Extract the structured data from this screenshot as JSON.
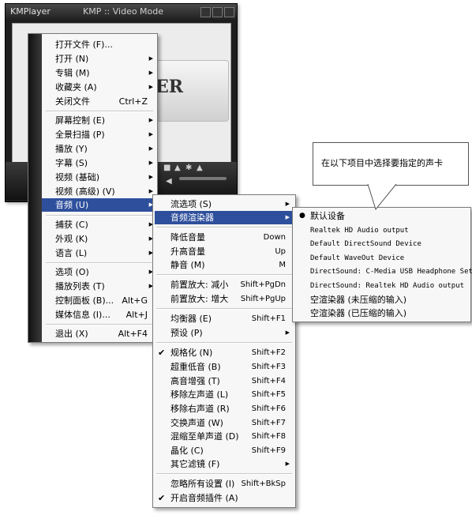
{
  "kmplayer": {
    "logo": "KMPlayer",
    "title": "KMP :: Video Mode",
    "logo_text": "ER"
  },
  "main_menu": {
    "items": [
      {
        "label": "打开文件 (F)...",
        "shortcut": "",
        "submenu": false
      },
      {
        "label": "打开 (N)",
        "shortcut": "",
        "submenu": true
      },
      {
        "label": "专辑 (M)",
        "shortcut": "",
        "submenu": true
      },
      {
        "label": "收藏夹 (A)",
        "shortcut": "",
        "submenu": true
      },
      {
        "label": "关闭文件",
        "shortcut": "Ctrl+Z",
        "submenu": false
      },
      {
        "label": "屏幕控制 (E)",
        "shortcut": "",
        "submenu": true
      },
      {
        "label": "全景扫描 (P)",
        "shortcut": "",
        "submenu": true
      },
      {
        "label": "播放 (Y)",
        "shortcut": "",
        "submenu": true
      },
      {
        "label": "字幕 (S)",
        "shortcut": "",
        "submenu": true
      },
      {
        "label": "视频 (基础)",
        "shortcut": "",
        "submenu": true
      },
      {
        "label": "视频 (高级) (V)",
        "shortcut": "",
        "submenu": true
      },
      {
        "label": "音频 (U)",
        "shortcut": "",
        "submenu": true
      },
      {
        "label": "捕获 (C)",
        "shortcut": "",
        "submenu": true
      },
      {
        "label": "外观 (K)",
        "shortcut": "",
        "submenu": true
      },
      {
        "label": "语言 (L)",
        "shortcut": "",
        "submenu": true
      },
      {
        "label": "选项 (O)",
        "shortcut": "",
        "submenu": true
      },
      {
        "label": "播放列表 (T)",
        "shortcut": "",
        "submenu": true
      },
      {
        "label": "控制面板 (B)...",
        "shortcut": "Alt+G",
        "submenu": false
      },
      {
        "label": "媒体信息 (I)...",
        "shortcut": "Alt+J",
        "submenu": false
      },
      {
        "label": "退出 (X)",
        "shortcut": "Alt+F4",
        "submenu": false
      }
    ]
  },
  "audio_menu": {
    "items": [
      {
        "label": "流选项 (S)",
        "shortcut": "",
        "submenu": true,
        "checked": false
      },
      {
        "label": "音频渲染器",
        "shortcut": "",
        "submenu": true,
        "checked": false
      },
      {
        "label": "降低音量",
        "shortcut": "Down",
        "submenu": false,
        "checked": false
      },
      {
        "label": "升高音量",
        "shortcut": "Up",
        "submenu": false,
        "checked": false
      },
      {
        "label": "静音 (M)",
        "shortcut": "M",
        "submenu": false,
        "checked": false
      },
      {
        "label": "前置放大: 减小",
        "shortcut": "Shift+PgDn",
        "submenu": false,
        "checked": false
      },
      {
        "label": "前置放大: 增大",
        "shortcut": "Shift+PgUp",
        "submenu": false,
        "checked": false
      },
      {
        "label": "均衡器 (E)",
        "shortcut": "Shift+F1",
        "submenu": false,
        "checked": false
      },
      {
        "label": "预设 (P)",
        "shortcut": "",
        "submenu": true,
        "checked": false
      },
      {
        "label": "规格化 (N)",
        "shortcut": "Shift+F2",
        "submenu": false,
        "checked": true
      },
      {
        "label": "超重低音 (B)",
        "shortcut": "Shift+F3",
        "submenu": false,
        "checked": false
      },
      {
        "label": "高音增强 (T)",
        "shortcut": "Shift+F4",
        "submenu": false,
        "checked": false
      },
      {
        "label": "移除左声道 (L)",
        "shortcut": "Shift+F5",
        "submenu": false,
        "checked": false
      },
      {
        "label": "移除右声道 (R)",
        "shortcut": "Shift+F6",
        "submenu": false,
        "checked": false
      },
      {
        "label": "交换声道 (W)",
        "shortcut": "Shift+F7",
        "submenu": false,
        "checked": false
      },
      {
        "label": "混缩至单声道 (D)",
        "shortcut": "Shift+F8",
        "submenu": false,
        "checked": false
      },
      {
        "label": "晶化 (C)",
        "shortcut": "Shift+F9",
        "submenu": false,
        "checked": false
      },
      {
        "label": "其它滤镜 (F)",
        "shortcut": "",
        "submenu": true,
        "checked": false
      },
      {
        "label": "忽略所有设置 (I)",
        "shortcut": "Shift+BkSp",
        "submenu": false,
        "checked": false
      },
      {
        "label": "开启音频插件 (A)",
        "shortcut": "",
        "submenu": false,
        "checked": true
      }
    ]
  },
  "device_menu": {
    "items": [
      {
        "label": "默认设备",
        "selected": true
      },
      {
        "label": "Realtek HD Audio output",
        "selected": false
      },
      {
        "label": "Default DirectSound Device",
        "selected": false
      },
      {
        "label": "Default WaveOut Device",
        "selected": false
      },
      {
        "label": "DirectSound: C-Media USB Headphone Set",
        "selected": false
      },
      {
        "label": "DirectSound: Realtek HD Audio output",
        "selected": false
      },
      {
        "label": "空渲染器 (未压缩的输入)",
        "selected": false
      },
      {
        "label": "空渲染器 (已压缩的输入)",
        "selected": false
      }
    ]
  },
  "callout": {
    "text": "在以下项目中选择要指定的声卡"
  },
  "colors": {
    "highlight": "#2e4f9c",
    "menu_bg": "#f7f7f7",
    "sidebar": "#1a1a1a"
  }
}
